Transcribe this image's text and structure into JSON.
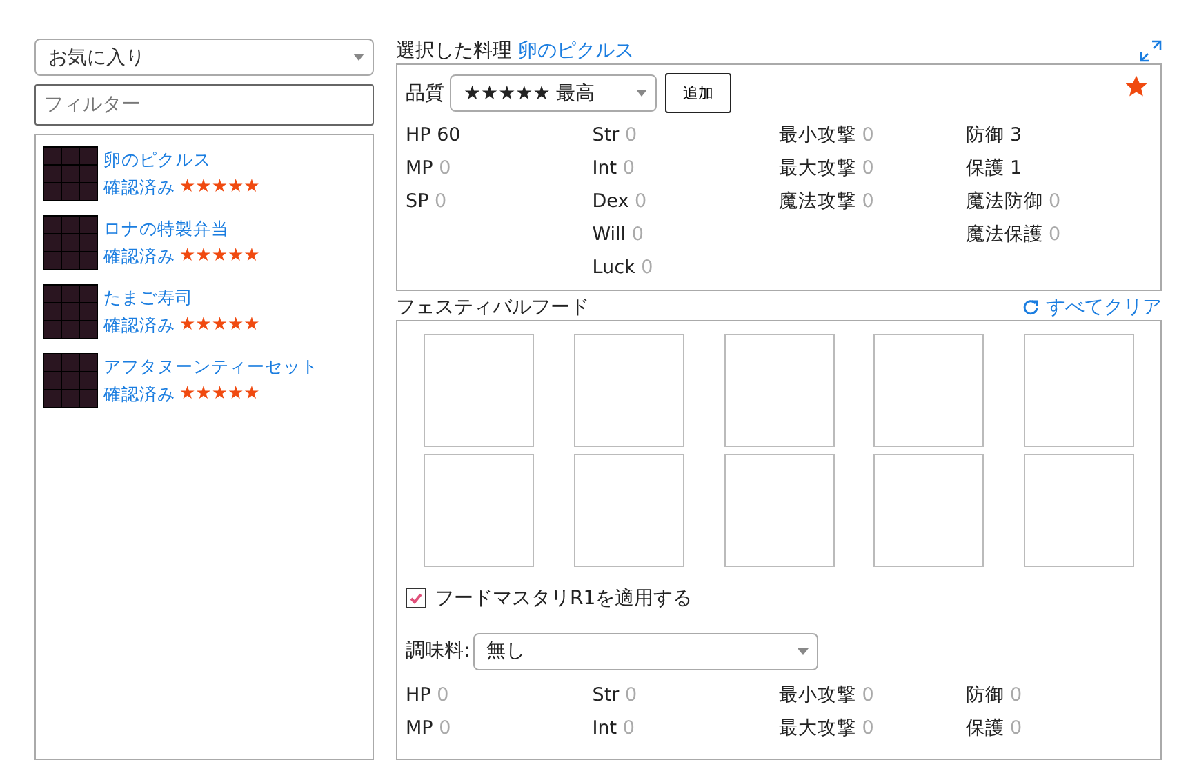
{
  "sidebar": {
    "category": "お気に入り",
    "filter": {
      "placeholder": "フィルター"
    },
    "items": [
      {
        "name": "卵のピクルス",
        "status": "確認済み",
        "stars": 5
      },
      {
        "name": "ロナの特製弁当",
        "status": "確認済み",
        "stars": 5
      },
      {
        "name": "たまご寿司",
        "status": "確認済み",
        "stars": 5
      },
      {
        "name": "アフタヌーンティーセット",
        "status": "確認済み",
        "stars": 5
      }
    ]
  },
  "selected": {
    "label": "選択した料理",
    "name": "卵のピクルス",
    "quality_label": "品質",
    "quality": "★★★★★ 最高",
    "add_button": "追加",
    "favorite": true,
    "stats": [
      [
        {
          "label": "HP",
          "value": "60",
          "dimmed": false
        },
        {
          "label": "MP",
          "value": "0",
          "dimmed": true
        },
        {
          "label": "SP",
          "value": "0",
          "dimmed": true
        }
      ],
      [
        {
          "label": "Str",
          "value": "0",
          "dimmed": true
        },
        {
          "label": "Int",
          "value": "0",
          "dimmed": true
        },
        {
          "label": "Dex",
          "value": "0",
          "dimmed": true
        },
        {
          "label": "Will",
          "value": "0",
          "dimmed": true
        },
        {
          "label": "Luck",
          "value": "0",
          "dimmed": true
        }
      ],
      [
        {
          "label": "最小攻撃",
          "value": "0",
          "dimmed": true
        },
        {
          "label": "最大攻撃",
          "value": "0",
          "dimmed": true
        },
        {
          "label": "魔法攻撃",
          "value": "0",
          "dimmed": true
        }
      ],
      [
        {
          "label": "防御",
          "value": "3",
          "dimmed": false
        },
        {
          "label": "保護",
          "value": "1",
          "dimmed": false
        },
        {
          "label": "魔法防御",
          "value": "0",
          "dimmed": true
        },
        {
          "label": "魔法保護",
          "value": "0",
          "dimmed": true
        }
      ]
    ]
  },
  "festival": {
    "title": "フェスティバルフード",
    "clear_all": "すべてクリア",
    "slots": [
      {
        "filled": false
      },
      {
        "filled": false
      },
      {
        "filled": false
      },
      {
        "filled": false
      },
      {
        "filled": false
      },
      {
        "filled": false
      },
      {
        "filled": false
      },
      {
        "filled": false
      },
      {
        "filled": false
      },
      {
        "filled": false
      }
    ],
    "mastery": {
      "label": "フードマスタリR1を適用する",
      "checked": true
    },
    "seasoning_label": "調味料:",
    "seasoning": "無し",
    "stats": [
      [
        {
          "label": "HP",
          "value": "0",
          "dimmed": true
        },
        {
          "label": "MP",
          "value": "0",
          "dimmed": true
        }
      ],
      [
        {
          "label": "Str",
          "value": "0",
          "dimmed": true
        },
        {
          "label": "Int",
          "value": "0",
          "dimmed": true
        }
      ],
      [
        {
          "label": "最小攻撃",
          "value": "0",
          "dimmed": true
        },
        {
          "label": "最大攻撃",
          "value": "0",
          "dimmed": true
        }
      ],
      [
        {
          "label": "防御",
          "value": "0",
          "dimmed": true
        },
        {
          "label": "保護",
          "value": "0",
          "dimmed": true
        }
      ]
    ]
  }
}
